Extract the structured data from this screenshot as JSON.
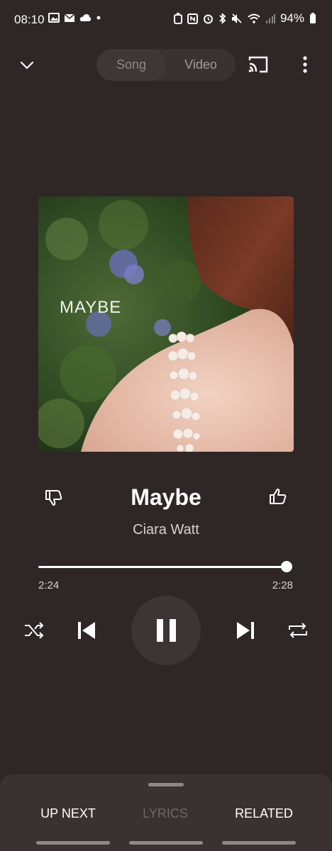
{
  "status_bar": {
    "time": "08:10",
    "battery": "94%"
  },
  "top_bar": {
    "tab_song": "Song",
    "tab_video": "Video"
  },
  "album": {
    "art_text": "MAYBE"
  },
  "track": {
    "title": "Maybe",
    "artist": "Ciara Watt"
  },
  "progress": {
    "elapsed": "2:24",
    "total": "2:28",
    "fraction": 0.97
  },
  "bottom_tabs": {
    "up_next": "UP NEXT",
    "lyrics": "LYRICS",
    "related": "RELATED"
  },
  "colors": {
    "background": "#2e2725",
    "sheet": "#3a3230",
    "play_button": "#3d3533"
  }
}
